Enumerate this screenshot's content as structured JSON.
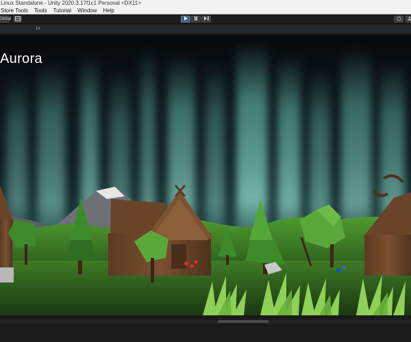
{
  "window": {
    "title": "Linux Standalone - Unity 2020.3.17f1c1 Personal <DX11>"
  },
  "menu": {
    "items": [
      "Store Tools",
      "Tools",
      "Tutorial",
      "Window",
      "Help"
    ]
  },
  "toolbar": {
    "global_label": "Global"
  },
  "gameview": {
    "scale_label": "1x"
  },
  "scene": {
    "title": "Aurora"
  }
}
